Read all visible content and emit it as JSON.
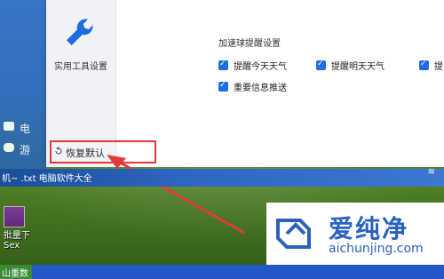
{
  "desktop": {
    "left_items": [
      "电",
      "游"
    ],
    "strip_text": "机~ .txt 电脑软件大全",
    "icon_label": "批量下",
    "icon_sublabel": "Sex",
    "taskbar_left": "山重数"
  },
  "dialog": {
    "nav": {
      "label": "实用工具设置"
    },
    "section_title": "加速球提醒设置",
    "options": [
      "提醒今天天气",
      "提醒明天天气",
      "提",
      "重要信息推送"
    ],
    "restore_label": "恢复默认"
  },
  "watermark": {
    "title": "爱纯净",
    "domain": "aichunjing.com"
  },
  "colors": {
    "accent": "#1e6de1",
    "highlight": "#e13a3a",
    "brand": "#2a62bd"
  }
}
